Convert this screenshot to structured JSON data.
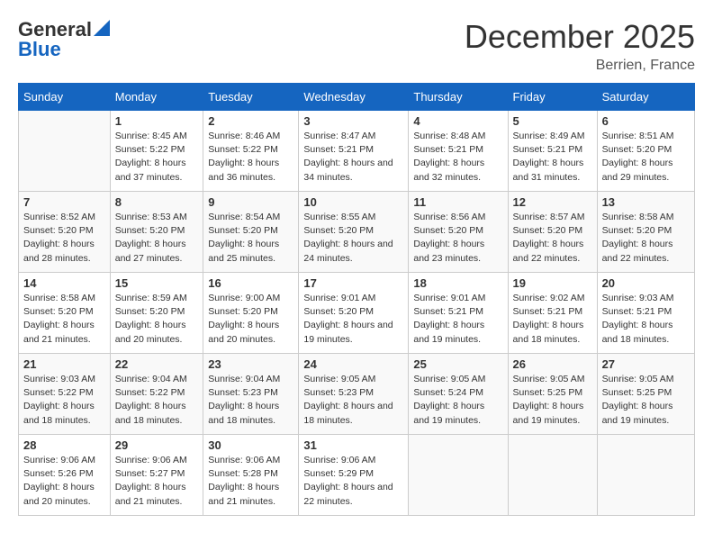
{
  "logo": {
    "line1": "General",
    "line2": "Blue"
  },
  "title": "December 2025",
  "subtitle": "Berrien, France",
  "headers": [
    "Sunday",
    "Monday",
    "Tuesday",
    "Wednesday",
    "Thursday",
    "Friday",
    "Saturday"
  ],
  "weeks": [
    [
      {
        "day": "",
        "content": ""
      },
      {
        "day": "1",
        "content": "Sunrise: 8:45 AM\nSunset: 5:22 PM\nDaylight: 8 hours\nand 37 minutes."
      },
      {
        "day": "2",
        "content": "Sunrise: 8:46 AM\nSunset: 5:22 PM\nDaylight: 8 hours\nand 36 minutes."
      },
      {
        "day": "3",
        "content": "Sunrise: 8:47 AM\nSunset: 5:21 PM\nDaylight: 8 hours\nand 34 minutes."
      },
      {
        "day": "4",
        "content": "Sunrise: 8:48 AM\nSunset: 5:21 PM\nDaylight: 8 hours\nand 32 minutes."
      },
      {
        "day": "5",
        "content": "Sunrise: 8:49 AM\nSunset: 5:21 PM\nDaylight: 8 hours\nand 31 minutes."
      },
      {
        "day": "6",
        "content": "Sunrise: 8:51 AM\nSunset: 5:20 PM\nDaylight: 8 hours\nand 29 minutes."
      }
    ],
    [
      {
        "day": "7",
        "content": "Sunrise: 8:52 AM\nSunset: 5:20 PM\nDaylight: 8 hours\nand 28 minutes."
      },
      {
        "day": "8",
        "content": "Sunrise: 8:53 AM\nSunset: 5:20 PM\nDaylight: 8 hours\nand 27 minutes."
      },
      {
        "day": "9",
        "content": "Sunrise: 8:54 AM\nSunset: 5:20 PM\nDaylight: 8 hours\nand 25 minutes."
      },
      {
        "day": "10",
        "content": "Sunrise: 8:55 AM\nSunset: 5:20 PM\nDaylight: 8 hours\nand 24 minutes."
      },
      {
        "day": "11",
        "content": "Sunrise: 8:56 AM\nSunset: 5:20 PM\nDaylight: 8 hours\nand 23 minutes."
      },
      {
        "day": "12",
        "content": "Sunrise: 8:57 AM\nSunset: 5:20 PM\nDaylight: 8 hours\nand 22 minutes."
      },
      {
        "day": "13",
        "content": "Sunrise: 8:58 AM\nSunset: 5:20 PM\nDaylight: 8 hours\nand 22 minutes."
      }
    ],
    [
      {
        "day": "14",
        "content": "Sunrise: 8:58 AM\nSunset: 5:20 PM\nDaylight: 8 hours\nand 21 minutes."
      },
      {
        "day": "15",
        "content": "Sunrise: 8:59 AM\nSunset: 5:20 PM\nDaylight: 8 hours\nand 20 minutes."
      },
      {
        "day": "16",
        "content": "Sunrise: 9:00 AM\nSunset: 5:20 PM\nDaylight: 8 hours\nand 20 minutes."
      },
      {
        "day": "17",
        "content": "Sunrise: 9:01 AM\nSunset: 5:20 PM\nDaylight: 8 hours\nand 19 minutes."
      },
      {
        "day": "18",
        "content": "Sunrise: 9:01 AM\nSunset: 5:21 PM\nDaylight: 8 hours\nand 19 minutes."
      },
      {
        "day": "19",
        "content": "Sunrise: 9:02 AM\nSunset: 5:21 PM\nDaylight: 8 hours\nand 18 minutes."
      },
      {
        "day": "20",
        "content": "Sunrise: 9:03 AM\nSunset: 5:21 PM\nDaylight: 8 hours\nand 18 minutes."
      }
    ],
    [
      {
        "day": "21",
        "content": "Sunrise: 9:03 AM\nSunset: 5:22 PM\nDaylight: 8 hours\nand 18 minutes."
      },
      {
        "day": "22",
        "content": "Sunrise: 9:04 AM\nSunset: 5:22 PM\nDaylight: 8 hours\nand 18 minutes."
      },
      {
        "day": "23",
        "content": "Sunrise: 9:04 AM\nSunset: 5:23 PM\nDaylight: 8 hours\nand 18 minutes."
      },
      {
        "day": "24",
        "content": "Sunrise: 9:05 AM\nSunset: 5:23 PM\nDaylight: 8 hours\nand 18 minutes."
      },
      {
        "day": "25",
        "content": "Sunrise: 9:05 AM\nSunset: 5:24 PM\nDaylight: 8 hours\nand 19 minutes."
      },
      {
        "day": "26",
        "content": "Sunrise: 9:05 AM\nSunset: 5:25 PM\nDaylight: 8 hours\nand 19 minutes."
      },
      {
        "day": "27",
        "content": "Sunrise: 9:05 AM\nSunset: 5:25 PM\nDaylight: 8 hours\nand 19 minutes."
      }
    ],
    [
      {
        "day": "28",
        "content": "Sunrise: 9:06 AM\nSunset: 5:26 PM\nDaylight: 8 hours\nand 20 minutes."
      },
      {
        "day": "29",
        "content": "Sunrise: 9:06 AM\nSunset: 5:27 PM\nDaylight: 8 hours\nand 21 minutes."
      },
      {
        "day": "30",
        "content": "Sunrise: 9:06 AM\nSunset: 5:28 PM\nDaylight: 8 hours\nand 21 minutes."
      },
      {
        "day": "31",
        "content": "Sunrise: 9:06 AM\nSunset: 5:29 PM\nDaylight: 8 hours\nand 22 minutes."
      },
      {
        "day": "",
        "content": ""
      },
      {
        "day": "",
        "content": ""
      },
      {
        "day": "",
        "content": ""
      }
    ]
  ]
}
